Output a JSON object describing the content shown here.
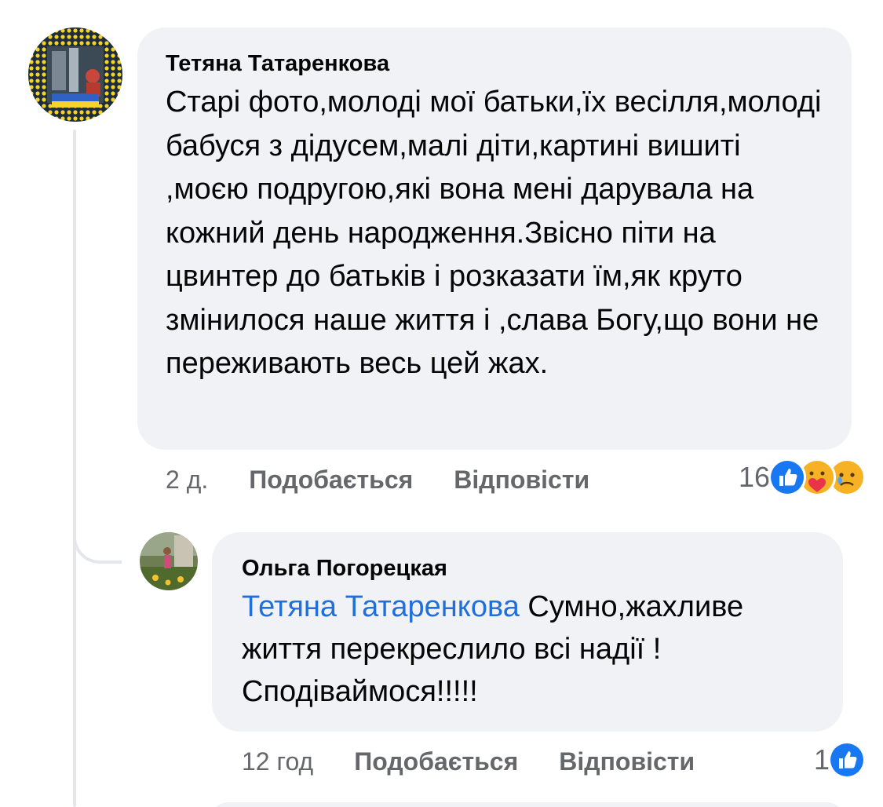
{
  "comments": [
    {
      "author": "Тетяна Татаренкова",
      "text": "Старі фото,молоді мої батьки,їх весілля,молоді бабуся з дідусем,малі діти,картині вишиті ,моєю подругою,які вона мені дарувала на кожний день народження.Звісно піти на цвинтер до батьків і розказати їм,як круто змінилося наше життя і ,слава Богу,що вони не переживають весь цей жах.",
      "time": "2 д.",
      "like_label": "Подобається",
      "reply_label": "Відповісти",
      "reaction_count": "16",
      "reactions": [
        "like-icon",
        "care-icon",
        "sad-icon"
      ]
    },
    {
      "author": "Ольга Погорецкая",
      "mention": "Тетяна Татаренкова",
      "text": " Сумно,жахливе життя перекреслило всі надії ! Сподіваймося!!!!!",
      "time": "12 год",
      "like_label": "Подобається",
      "reply_label": "Відповісти",
      "reaction_count": "1",
      "reactions": [
        "like-icon"
      ]
    }
  ],
  "colors": {
    "bubble": "#f0f2f5",
    "mention": "#216fdb",
    "meta": "#65676b",
    "like_blue": "#1877f2"
  }
}
